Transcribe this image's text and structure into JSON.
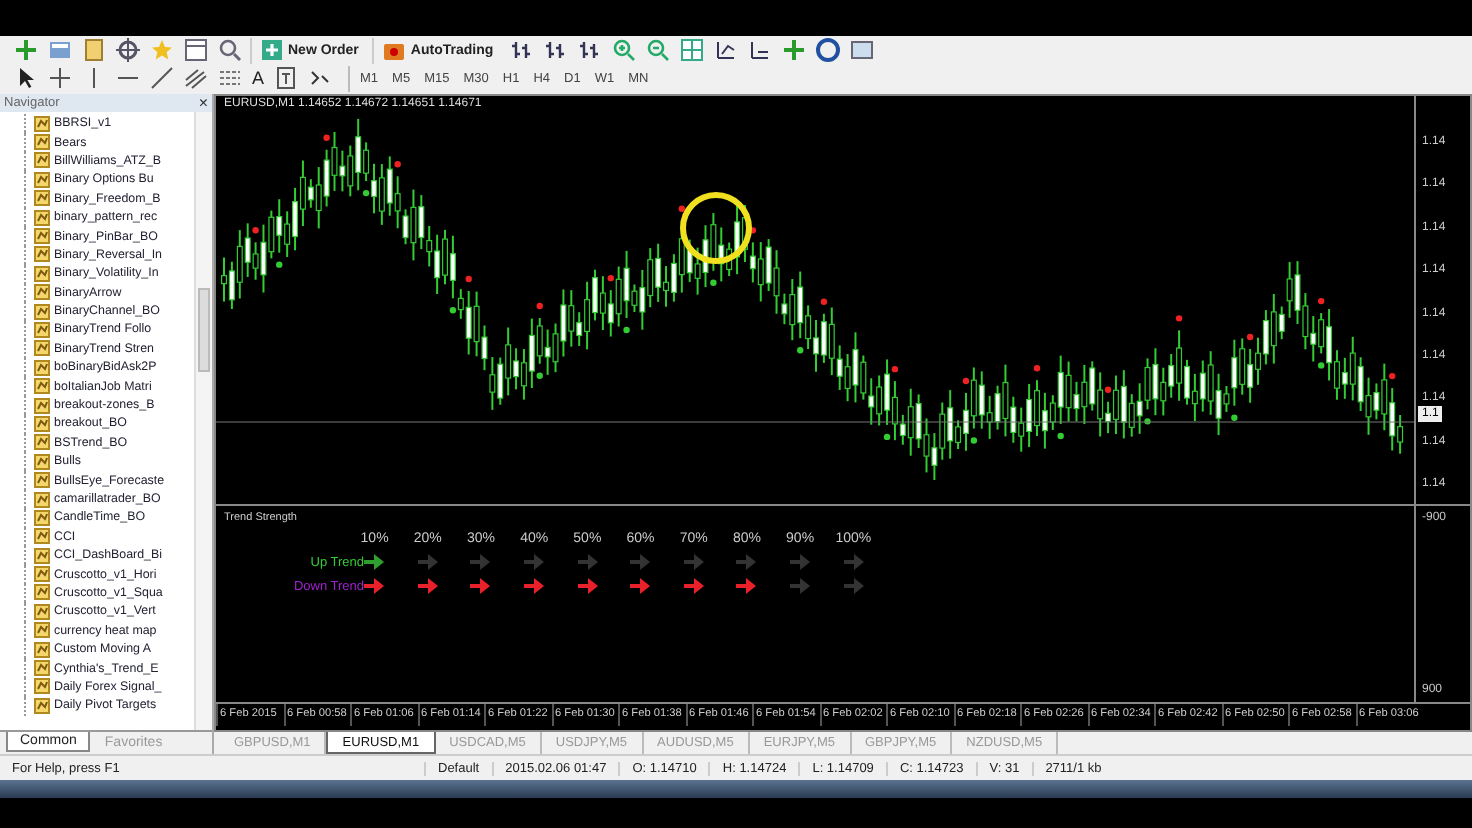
{
  "toolbar": {
    "buttons": [
      {
        "label": "New Order",
        "kind": "order"
      },
      {
        "label": "AutoTrading",
        "kind": "auto"
      }
    ],
    "text_tool": "A",
    "timeframes": [
      "M1",
      "M5",
      "M15",
      "M30",
      "H1",
      "H4",
      "D1",
      "W1",
      "MN"
    ]
  },
  "navigator": {
    "title": "Navigator",
    "close": "×",
    "items": [
      "BBRSI_v1",
      "Bears",
      "BillWilliams_ATZ_B",
      "Binary Options Bu",
      "Binary_Freedom_B",
      "binary_pattern_rec",
      "Binary_PinBar_BO",
      "Binary_Reversal_In",
      "Binary_Volatility_In",
      "BinaryArrow",
      "BinaryChannel_BO",
      "BinaryTrend Follo",
      "BinaryTrend Stren",
      "boBinaryBidAsk2P",
      "boItalianJob Matri",
      "breakout-zones_B",
      "breakout_BO",
      "BSTrend_BO",
      "Bulls",
      "BullsEye_Forecaste",
      "camarillatrader_BO",
      "CandleTime_BO",
      "CCI",
      "CCI_DashBoard_Bi",
      "Cruscotto_v1_Hori",
      "Cruscotto_v1_Squa",
      "Cruscotto_v1_Vert",
      "currency heat map",
      "Custom Moving A",
      "Cynthia's_Trend_E",
      "Daily Forex Signal_",
      "Daily Pivot Targets"
    ],
    "tabs": [
      {
        "label": "Common",
        "selected": true
      },
      {
        "label": "Favorites",
        "selected": false
      }
    ]
  },
  "chart": {
    "title": "EURUSD,M1  1.14652 1.14672 1.14651 1.14671",
    "price_labels": [
      "1.14",
      "1.14",
      "1.14",
      "1.14",
      "1.14",
      "1.14",
      "1.14",
      "1.14",
      "1.14"
    ],
    "current_price": "1.1"
  },
  "indicator": {
    "title": "Trend Strength",
    "axis_labels": [
      "-900",
      "900"
    ],
    "columns": [
      "10%",
      "20%",
      "30%",
      "40%",
      "50%",
      "60%",
      "70%",
      "80%",
      "90%",
      "100%"
    ],
    "rows": [
      {
        "label": "Up Trend",
        "kind": "up",
        "arrows": [
          {
            "on": true
          },
          {
            "on": false
          },
          {
            "on": false
          },
          {
            "on": false
          },
          {
            "on": false
          },
          {
            "on": false
          },
          {
            "on": false
          },
          {
            "on": false
          },
          {
            "on": false
          },
          {
            "on": false
          }
        ]
      },
      {
        "label": "Down Trend",
        "kind": "down",
        "arrows": [
          {
            "on": true
          },
          {
            "on": true
          },
          {
            "on": true
          },
          {
            "on": true
          },
          {
            "on": true
          },
          {
            "on": true
          },
          {
            "on": true
          },
          {
            "on": true
          },
          {
            "on": false
          },
          {
            "on": false
          }
        ]
      }
    ]
  },
  "time_axis": [
    "6 Feb 2015",
    "6 Feb 00:58",
    "6 Feb 01:06",
    "6 Feb 01:14",
    "6 Feb 01:22",
    "6 Feb 01:30",
    "6 Feb 01:38",
    "6 Feb 01:46",
    "6 Feb 01:54",
    "6 Feb 02:02",
    "6 Feb 02:10",
    "6 Feb 02:18",
    "6 Feb 02:26",
    "6 Feb 02:34",
    "6 Feb 02:42",
    "6 Feb 02:50",
    "6 Feb 02:58",
    "6 Feb 03:06"
  ],
  "chart_tabs": [
    {
      "label": "GBPUSD,M1",
      "selected": false
    },
    {
      "label": "EURUSD,M1",
      "selected": true
    },
    {
      "label": "USDCAD,M5",
      "selected": false
    },
    {
      "label": "USDJPY,M5",
      "selected": false
    },
    {
      "label": "AUDUSD,M5",
      "selected": false
    },
    {
      "label": "EURJPY,M5",
      "selected": false
    },
    {
      "label": "GBPJPY,M5",
      "selected": false
    },
    {
      "label": "NZDUSD,M5",
      "selected": false
    }
  ],
  "status_bar": [
    "For Help, press F1",
    "Default",
    "2015.02.06 01:47",
    "O: 1.14710",
    "H: 1.14724",
    "L: 1.14709",
    "C: 1.14723",
    "V: 31",
    "2711/1 kb"
  ]
}
